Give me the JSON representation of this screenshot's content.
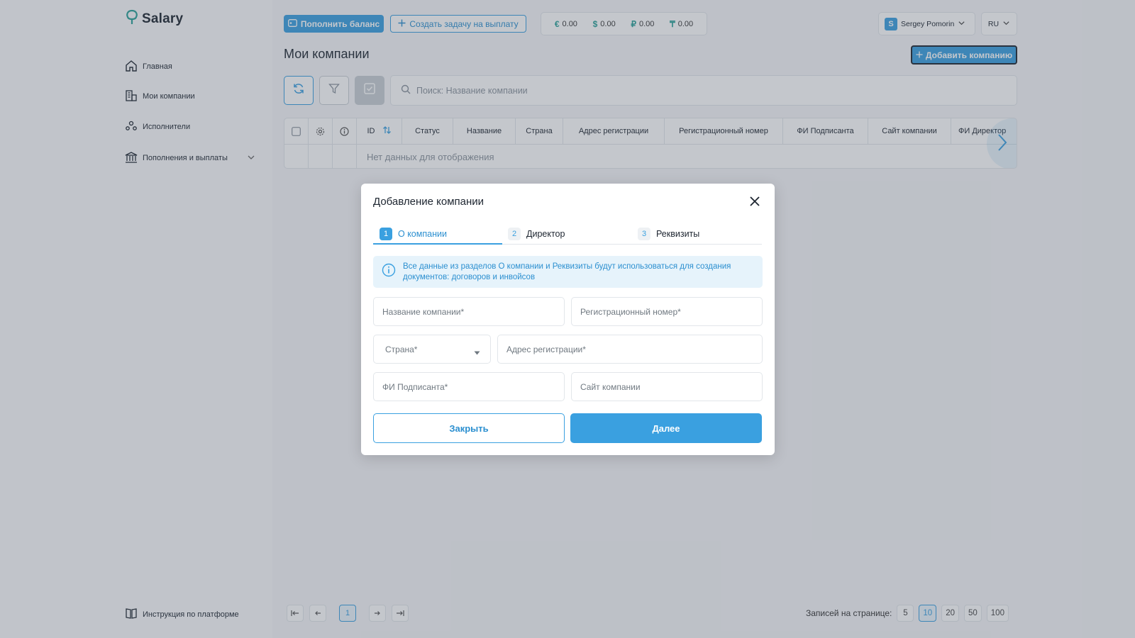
{
  "app": {
    "logo_text": "Salary"
  },
  "sidebar": {
    "items": [
      {
        "label": "Главная",
        "icon": "home-icon"
      },
      {
        "label": "Мои компании",
        "icon": "building-icon"
      },
      {
        "label": "Исполнители",
        "icon": "people-icon"
      },
      {
        "label": "Пополнения и выплаты",
        "icon": "bank-icon"
      }
    ],
    "bottom_link": "Инструкция по платформе"
  },
  "header": {
    "topup_label": "Пополнить баланс",
    "create_task_label": "Создать задачу на выплату",
    "balances": [
      {
        "currency": "€",
        "amount": "0.00"
      },
      {
        "currency": "$",
        "amount": "0.00"
      },
      {
        "currency": "₽",
        "amount": "0.00"
      },
      {
        "currency": "₸",
        "amount": "0.00"
      }
    ],
    "user_initial": "S",
    "user_name": "Sergey Pomorin",
    "language": "RU"
  },
  "page": {
    "title": "Мои компании",
    "add_company_label": "Добавить компанию",
    "search_placeholder": "Поиск:  Название компании"
  },
  "table": {
    "columns": [
      "ID",
      "Статус",
      "Название",
      "Страна",
      "Адрес регистрации",
      "Регистрационный номер",
      "ФИ Подписанта",
      "Сайт компании",
      "ФИ Директор"
    ],
    "empty_text": "Нет данных для отображения"
  },
  "pagination": {
    "current_page": "1",
    "per_page_label": "Записей на странице:",
    "per_page_options": [
      "5",
      "10",
      "20",
      "50",
      "100"
    ],
    "per_page_selected": "10"
  },
  "modal": {
    "title": "Добавление компании",
    "steps": [
      {
        "num": "1",
        "label": "О компании"
      },
      {
        "num": "2",
        "label": "Директор"
      },
      {
        "num": "3",
        "label": "Реквизиты"
      }
    ],
    "info_text": "Все данные из разделов О компании и Реквизиты будут использоваться для создания документов: договоров и инвойсов",
    "fields": {
      "company_name": "Название компании*",
      "reg_number": "Регистрационный номер*",
      "country": "Страна*",
      "reg_address": "Адрес регистрации*",
      "signer_name": "ФИ Подписанта*",
      "website": "Сайт компании"
    },
    "close_label": "Закрыть",
    "next_label": "Далее"
  },
  "colors": {
    "accent": "#3aa0e0",
    "currency": "#2aa198",
    "text": "#1d2530"
  }
}
